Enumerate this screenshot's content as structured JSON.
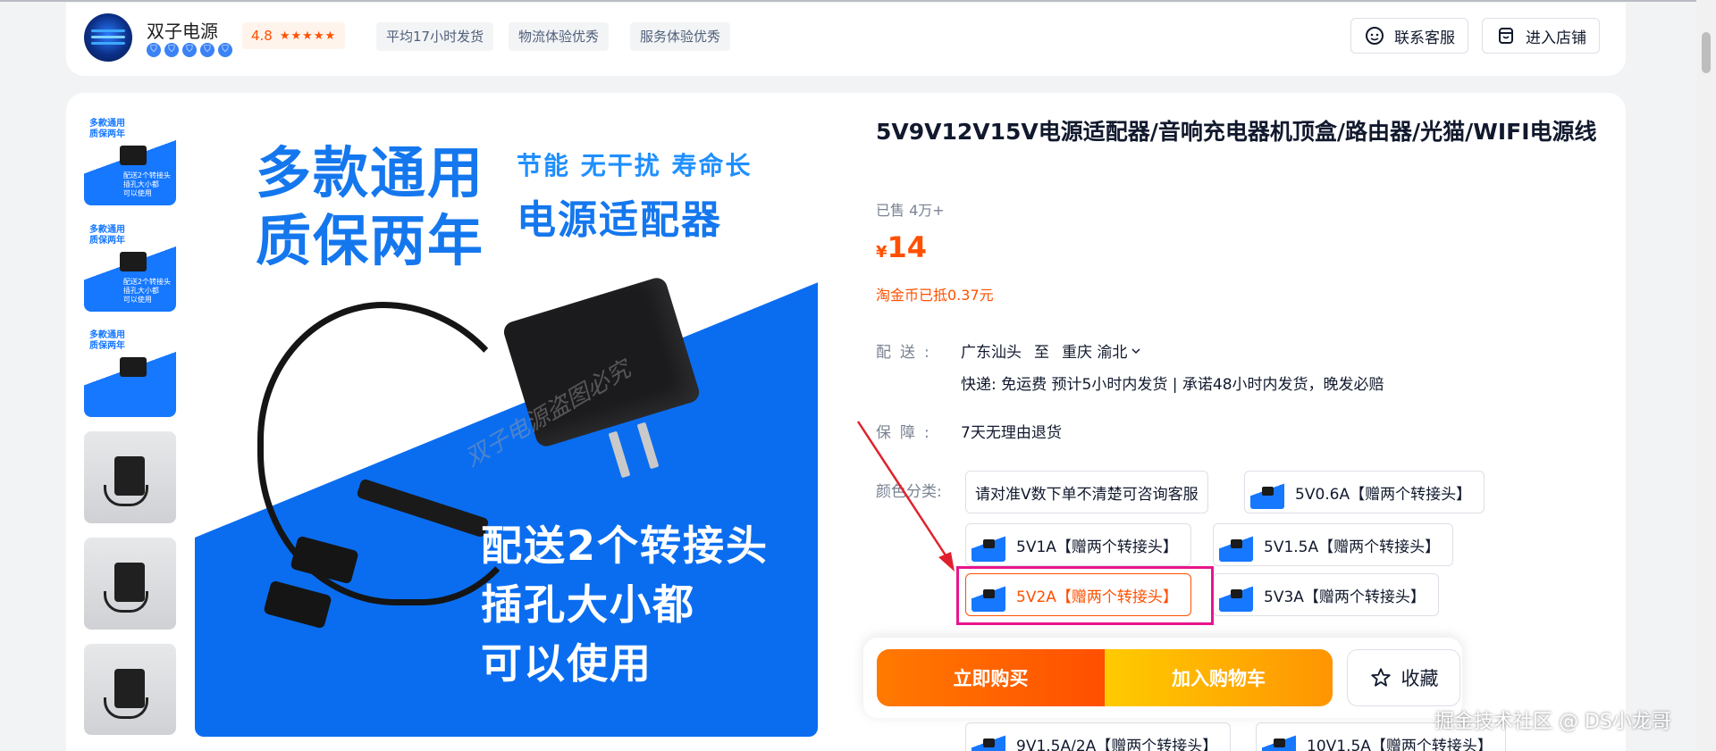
{
  "shop": {
    "name": "双子电源",
    "crowns": [
      "⛉",
      "⛉",
      "⛉",
      "⛉",
      "⛉"
    ],
    "rating": "4.8",
    "stars": "★★★★★",
    "tags": [
      "平均17小时发货",
      "物流体验优秀",
      "服务体验优秀"
    ],
    "contact_label": "联系客服",
    "enter_store_label": "进入店铺"
  },
  "gallery": {
    "thumb_text_top": "多款通用\n质保两年",
    "thumb_text_right": "节能 无干扰 寿命长\n电源适配器",
    "thumb_text_bottom": "配送2个转接头\n插孔大小都\n可以使用"
  },
  "main_image": {
    "headline": "多款通用\n质保两年",
    "features": "节能 无干扰 寿命长",
    "product_name": "电源适配器",
    "bottom_text": "配送2个转接头\n插孔大小都\n可以使用",
    "watermark": "双子电源盗图必究"
  },
  "product": {
    "title": "5V9V12V15V电源适配器/音响充电器机顶盒/路由器/光猫/WIFI电源线",
    "sold": "已售 4万+",
    "currency": "¥",
    "price": "14",
    "coin_note": "淘金币已抵0.37元"
  },
  "delivery": {
    "label": "配送:",
    "from": "广东汕头",
    "to_word": "至",
    "to": "重庆 渝北",
    "detail": "快递: 免运费  预计5小时内发货 | 承诺48小时内发货，晚发必赔"
  },
  "guarantee": {
    "label": "保障:",
    "value": "7天无理由退货"
  },
  "options": {
    "label": "颜色分类:",
    "items": [
      "请对准V数下单不清楚可咨询客服",
      "5V0.6A【赠两个转接头】",
      "5V1A【赠两个转接头】",
      "5V1.5A【赠两个转接头】",
      "5V2A【赠两个转接头】",
      "5V3A【赠两个转接头】",
      "9V1.5A/2A【赠两个转接头】",
      "10V1.5A【赠两个转接头】"
    ],
    "selected_index": 4,
    "accent": "#ff5000"
  },
  "actions": {
    "buy_now": "立即购买",
    "add_cart": "加入购物车",
    "favorite": "收藏"
  },
  "watermark_footer": "掘金技术社区 @ DS小龙哥",
  "colors": {
    "accent": "#ff5000",
    "highlight_box": "#e8158c",
    "arrow": "#e0212b"
  }
}
